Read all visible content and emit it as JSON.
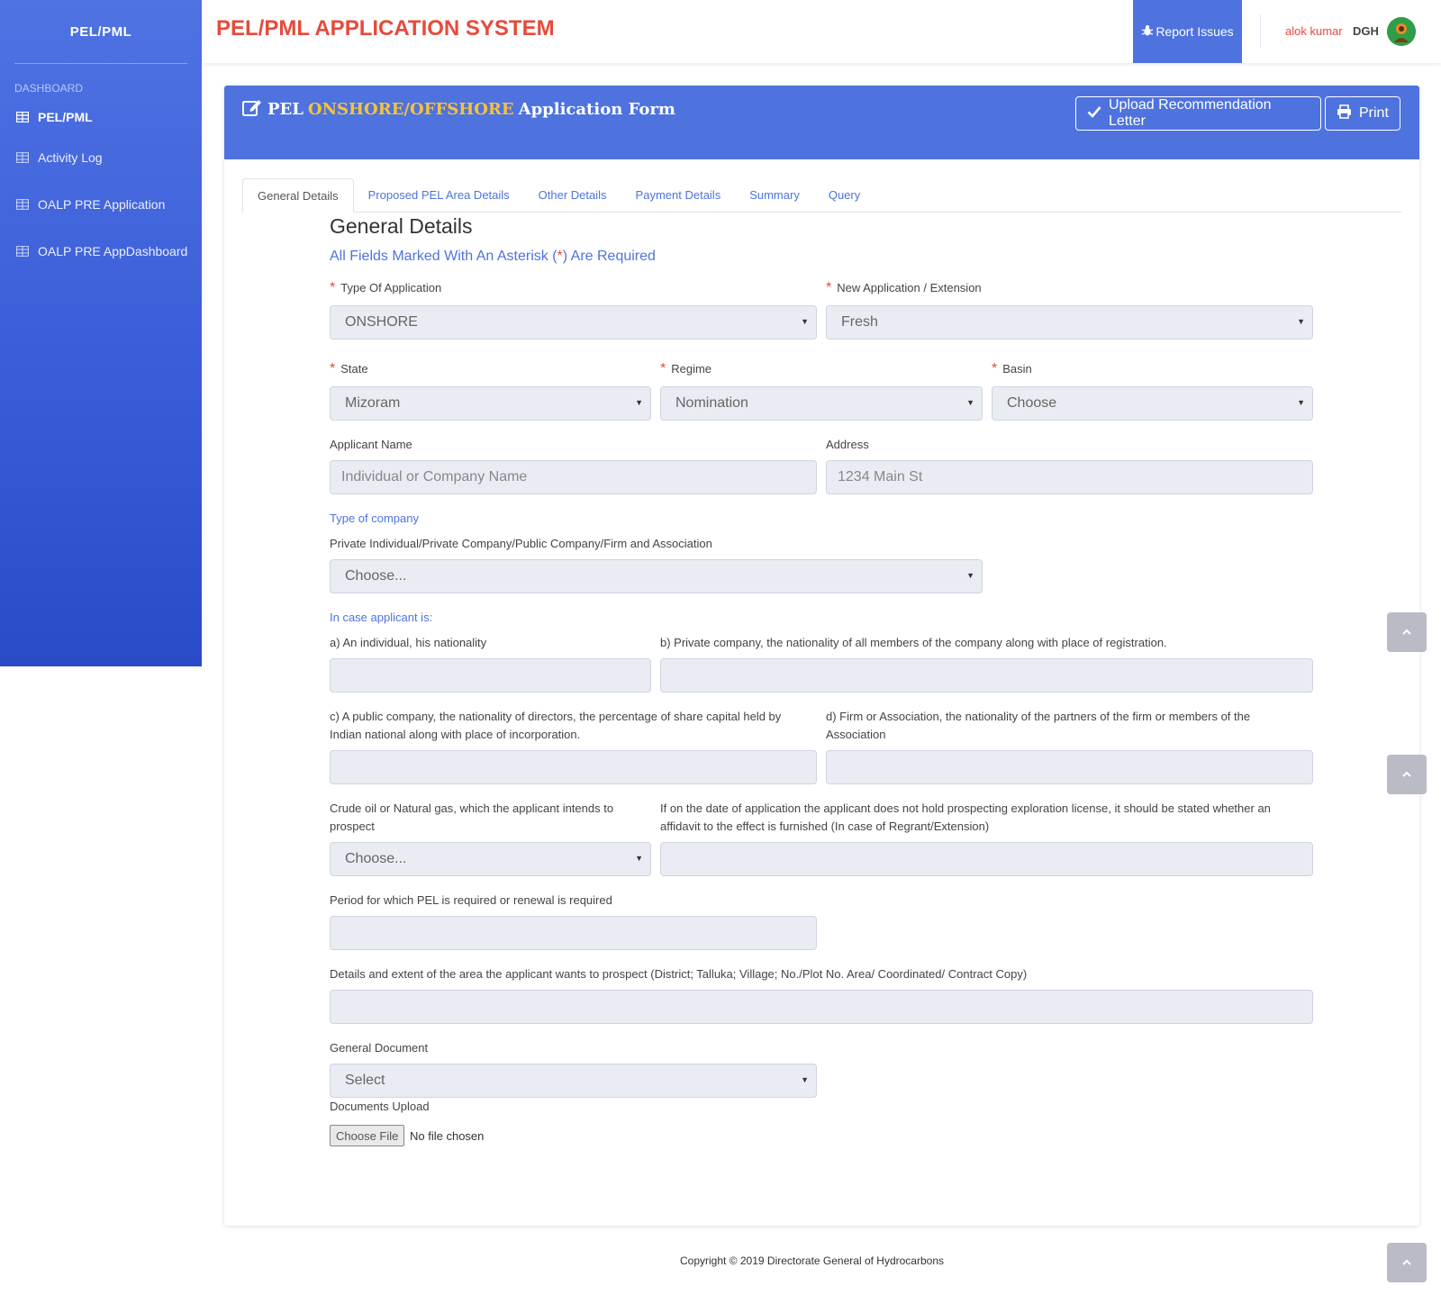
{
  "sidebar": {
    "brand": "PEL/PML",
    "section": "DASHBOARD",
    "items": [
      {
        "label": "PEL/PML"
      },
      {
        "label": "Activity Log"
      },
      {
        "label": "OALP PRE Application"
      },
      {
        "label": "OALP PRE AppDashboard"
      }
    ]
  },
  "header": {
    "title": "PEL/PML APPLICATION SYSTEM",
    "report_label": "Report Issues",
    "user_name": "alok kumar",
    "org": "DGH"
  },
  "form": {
    "title_prefix": "PEL",
    "title_highlight": "ONSHORE/OFFSHORE",
    "title_suffix": "Application Form",
    "upload_label": "Upload Recommendation Letter",
    "print_label": "Print"
  },
  "tabs": [
    {
      "label": "General Details"
    },
    {
      "label": "Proposed PEL Area Details"
    },
    {
      "label": "Other Details"
    },
    {
      "label": "Payment Details"
    },
    {
      "label": "Summary"
    },
    {
      "label": "Query"
    }
  ],
  "general": {
    "heading": "General Details",
    "required_note_pre": "All Fields Marked With An Asterisk (",
    "required_note_star": "*",
    "required_note_post": ") Are Required",
    "type_of_application": {
      "label": "Type Of Application",
      "value": "ONSHORE"
    },
    "new_extension": {
      "label": "New Application / Extension",
      "value": "Fresh"
    },
    "state": {
      "label": "State",
      "value": "Mizoram"
    },
    "regime": {
      "label": "Regime",
      "value": "Nomination"
    },
    "basin": {
      "label": "Basin",
      "value": "Choose"
    },
    "applicant_name": {
      "label": "Applicant Name",
      "placeholder": "Individual or Company Name"
    },
    "address": {
      "label": "Address",
      "placeholder": "1234 Main St"
    },
    "type_of_company_section": "Type of company",
    "company_type": {
      "label": "Private Individual/Private Company/Public Company/Firm and Association",
      "value": "Choose..."
    },
    "in_case_section": "In case applicant is:",
    "individual": {
      "label": "a) An individual, his nationality"
    },
    "private_company": {
      "label": "b) Private company, the nationality of all members of the company along with place of registration."
    },
    "public_company": {
      "label": "c) A public company, the nationality of directors, the percentage of share capital held by Indian national along with place of incorporation."
    },
    "firm": {
      "label": "d) Firm or Association, the nationality of the partners of the firm or members of the Association"
    },
    "crude_gas": {
      "label": "Crude oil or Natural gas, which the applicant intends to prospect",
      "value": "Choose..."
    },
    "affidavit": {
      "label": "If on the date of application the applicant does not hold prospecting exploration license, it should be stated whether an affidavit to the effect is furnished (In case of Regrant/Extension)"
    },
    "period": {
      "label": "Period for which PEL is required or renewal is required"
    },
    "area_details": {
      "label": "Details and extent of the area the applicant wants to prospect (District; Talluka; Village; No./Plot No. Area/ Coordinated/ Contract Copy)"
    },
    "general_document": {
      "label": "General Document",
      "value": "Select"
    },
    "documents_upload": {
      "label": "Documents Upload",
      "button": "Choose File",
      "status": "No file chosen"
    }
  },
  "footer": {
    "copyright": "Copyright © 2019 Directorate General of Hydrocarbons"
  },
  "colors": {
    "primary": "#4e73df",
    "danger": "#e74a3b",
    "highlight": "#f6c23e"
  }
}
